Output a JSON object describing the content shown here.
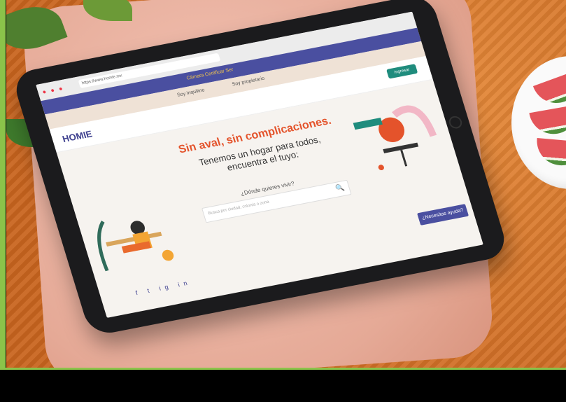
{
  "browser": {
    "url": "https://www.homie.mx",
    "top_banner": "Cámara Certificar Ser"
  },
  "roles": {
    "tenant": "Soy inquilino",
    "owner": "Soy propietario"
  },
  "header": {
    "logo": "HOMIE",
    "login_button": "Ingresar"
  },
  "hero": {
    "title": "Sin aval, sin complicaciones.",
    "subtitle_line1": "Tenemos un hogar para todos,",
    "subtitle_line2": "encuentra el tuyo:"
  },
  "search": {
    "question": "¿Dónde quieres vivir?",
    "placeholder": "Busca por ciudad, colonia o zona",
    "icon": "search-icon"
  },
  "help_button": "¿Necesitas ayuda?",
  "social": [
    "f",
    "t",
    "ig",
    "in"
  ],
  "colors": {
    "accent": "#e4532b",
    "nav": "#4a4fa0",
    "button": "#1f8c7d",
    "pillow": "#e5a996",
    "blanket": "#d9762f"
  }
}
